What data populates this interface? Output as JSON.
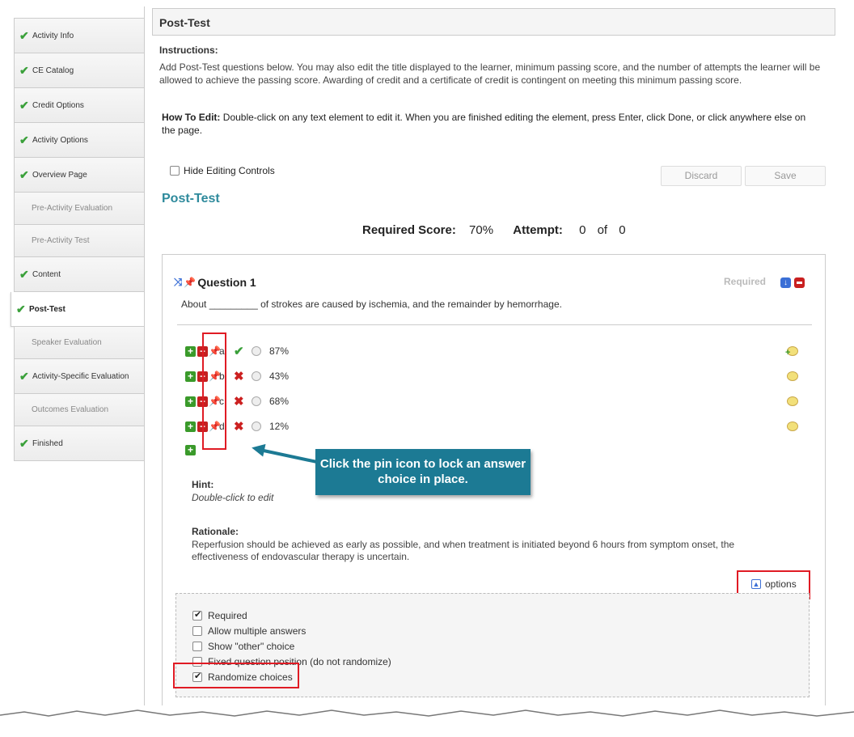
{
  "sidebar": {
    "items": [
      {
        "label": "Activity Info",
        "done": true
      },
      {
        "label": "CE Catalog",
        "done": true
      },
      {
        "label": "Credit Options",
        "done": true
      },
      {
        "label": "Activity Options",
        "done": true
      },
      {
        "label": "Overview Page",
        "done": true
      },
      {
        "label": "Pre-Activity Evaluation",
        "done": false
      },
      {
        "label": "Pre-Activity Test",
        "done": false
      },
      {
        "label": "Content",
        "done": true
      },
      {
        "label": "Post-Test",
        "done": true,
        "active": true
      },
      {
        "label": "Speaker Evaluation",
        "done": false
      },
      {
        "label": "Activity-Specific Evaluation",
        "done": true
      },
      {
        "label": "Outcomes Evaluation",
        "done": false
      },
      {
        "label": "Finished",
        "done": true
      }
    ]
  },
  "header": {
    "title": "Post-Test"
  },
  "instructions": {
    "title": "Instructions:",
    "text": "Add Post-Test questions below. You may also edit the title displayed to the learner, minimum passing score, and the number of attempts the learner will be allowed to achieve the passing score. Awarding of credit and a certificate of credit is contingent on meeting this minimum passing score.",
    "howto_label": "How To Edit:",
    "howto_text": " Double-click on any text element to edit it. When you are finished editing the element, press Enter, click Done, or click anywhere else on the page."
  },
  "controls": {
    "hide_editing": "Hide Editing Controls",
    "discard": "Discard",
    "save": "Save"
  },
  "test": {
    "heading": "Post-Test",
    "required_label": "Required Score:",
    "required_value": "70%",
    "attempt_label": "Attempt:",
    "attempt_current": "0",
    "attempt_of": "of",
    "attempt_total": "0"
  },
  "question": {
    "title": "Question 1",
    "required_tag": "Required",
    "text": "About _________ of strokes are caused by ischemia, and the remainder by hemorrhage.",
    "answers": [
      {
        "letter": "a.",
        "value": "87%",
        "correct": true
      },
      {
        "letter": "b.",
        "value": "43%",
        "correct": false
      },
      {
        "letter": "c.",
        "value": "68%",
        "correct": false
      },
      {
        "letter": "d.",
        "value": "12%",
        "correct": false
      }
    ],
    "hint_label": "Hint:",
    "hint_text": "Double-click to edit",
    "rationale_label": "Rationale:",
    "rationale_text": "Reperfusion should be achieved as early as possible, and when treatment is initiated beyond 6 hours from symptom onset, the effectiveness of endovascular therapy is uncertain.",
    "options_link": "options",
    "options": [
      {
        "label": "Required",
        "checked": true
      },
      {
        "label": "Allow multiple answers",
        "checked": false
      },
      {
        "label": "Show \"other\" choice",
        "checked": false
      },
      {
        "label": "Fixed question position (do not randomize)",
        "checked": false
      },
      {
        "label": "Randomize choices",
        "checked": true
      }
    ]
  },
  "callout": {
    "text": "Click the pin icon to lock an answer choice in place."
  },
  "colors": {
    "accent": "#2e8a9c",
    "callout": "#1c7a94",
    "highlight": "#e01b24"
  }
}
